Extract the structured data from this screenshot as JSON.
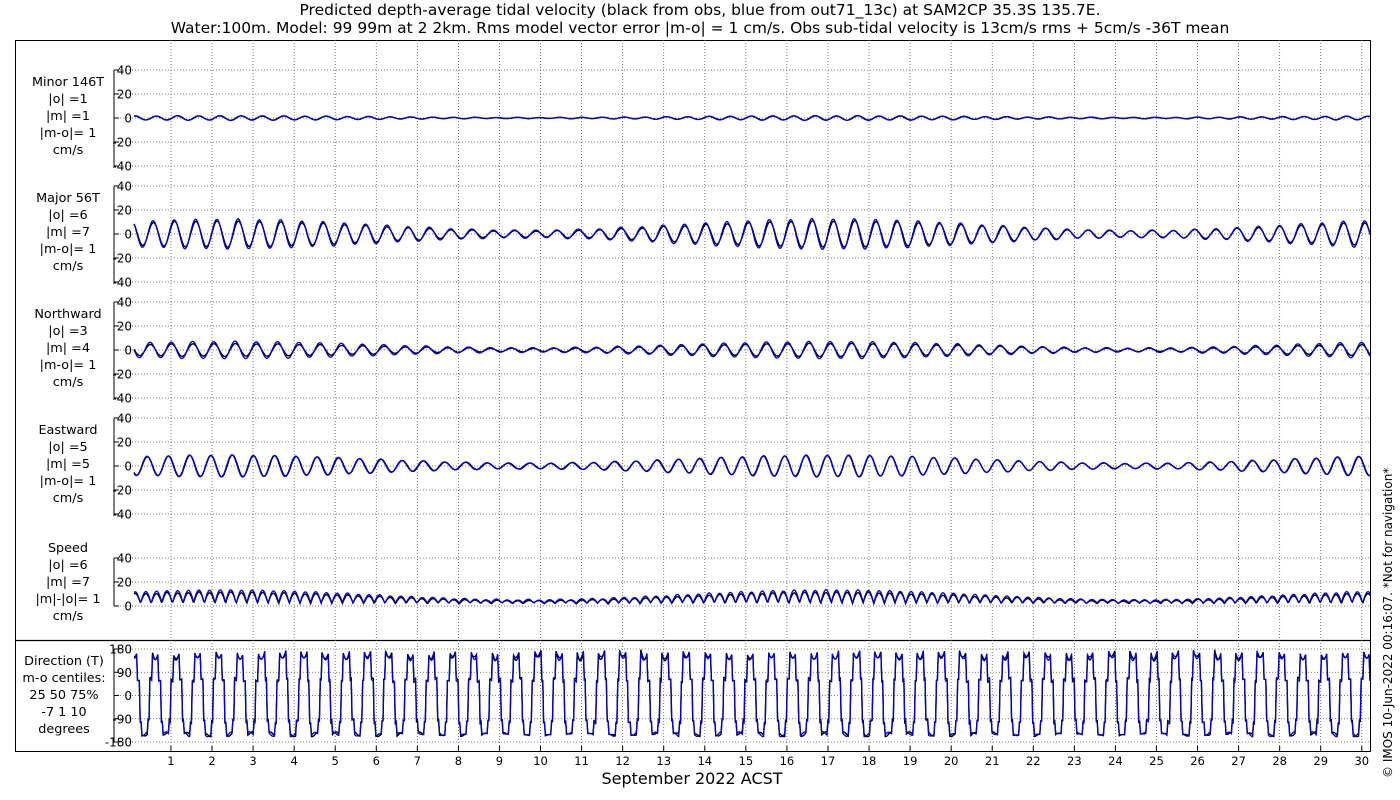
{
  "title_lines": [
    "Predicted depth-average tidal velocity (black from obs, blue from out71_13c) at SAM2CP 35.3S 135.7E.",
    "Water:100m. Model: 99 99m at 2 2km. Rms model vector error |m-o| = 1 cm/s. Obs sub-tidal velocity is 13cm/s rms + 5cm/s -36T mean"
  ],
  "credit": "© IMOS 10-Jun-2022 00:16:07.  *Not for navigation*",
  "colors": {
    "obs": "#000000",
    "model": "#0000cc",
    "grid": "#555555"
  },
  "chart_data": [
    {
      "type": "line",
      "name_label": [
        "Minor 146T",
        "|o| =1",
        "|m| =1",
        "|m-o|= 1",
        "cm/s"
      ],
      "ylim": [
        -40,
        40
      ],
      "yticks": [
        -40,
        -20,
        0,
        20,
        40
      ],
      "grid": true,
      "series": [
        {
          "name": "black from obs",
          "amplitude": 1,
          "mean": 0
        },
        {
          "name": "blue from out71_13c",
          "amplitude": 1,
          "mean": 0
        }
      ]
    },
    {
      "type": "line",
      "name_label": [
        "Major 56T",
        "|o| =6",
        "|m| =7",
        "|m-o|= 1",
        "cm/s"
      ],
      "ylim": [
        -40,
        40
      ],
      "yticks": [
        -40,
        -20,
        0,
        20,
        40
      ],
      "grid": true,
      "series": [
        {
          "name": "black from obs",
          "amplitude": 6,
          "mean": 0
        },
        {
          "name": "blue from out71_13c",
          "amplitude": 7,
          "mean": 0
        }
      ]
    },
    {
      "type": "line",
      "name_label": [
        "Northward",
        "|o| =3",
        "|m| =4",
        "|m-o|= 1",
        "cm/s"
      ],
      "ylim": [
        -40,
        40
      ],
      "yticks": [
        -40,
        -20,
        0,
        20,
        40
      ],
      "grid": true,
      "series": [
        {
          "name": "black from obs",
          "amplitude": 3,
          "mean": 0
        },
        {
          "name": "blue from out71_13c",
          "amplitude": 4,
          "mean": 0
        }
      ]
    },
    {
      "type": "line",
      "name_label": [
        "Eastward",
        "|o| =5",
        "|m| =5",
        "|m-o|= 1",
        "cm/s"
      ],
      "ylim": [
        -40,
        40
      ],
      "yticks": [
        -40,
        -20,
        0,
        20,
        40
      ],
      "grid": true,
      "series": [
        {
          "name": "black from obs",
          "amplitude": 5,
          "mean": 0
        },
        {
          "name": "blue from out71_13c",
          "amplitude": 5,
          "mean": 0
        }
      ]
    },
    {
      "type": "line",
      "name_label": [
        "Speed",
        "|o| =6",
        "|m| =7",
        "|m|-|o|= 1",
        "cm/s"
      ],
      "ylim": [
        0,
        40
      ],
      "yticks": [
        0,
        20,
        40
      ],
      "grid": true,
      "series": [
        {
          "name": "black from obs",
          "amplitude": 6,
          "mean": 6
        },
        {
          "name": "blue from out71_13c",
          "amplitude": 7,
          "mean": 7
        }
      ]
    },
    {
      "type": "line",
      "name_label": [
        "Direction (T)",
        "m-o centiles:",
        "25  50  75%",
        "-7   1  10",
        "degrees"
      ],
      "ylim": [
        -180,
        180
      ],
      "yticks": [
        -180,
        -90,
        0,
        90,
        180
      ],
      "grid": true,
      "centiles": {
        "25": -7,
        "50": 1,
        "75": 10
      },
      "series": [
        {
          "name": "black from obs"
        },
        {
          "name": "blue from out71_13c"
        }
      ]
    }
  ],
  "x_axis": {
    "label": "September 2022 ACST",
    "ticks": [
      "1",
      "2",
      "3",
      "4",
      "5",
      "6",
      "7",
      "8",
      "9",
      "10",
      "11",
      "12",
      "13",
      "14",
      "15",
      "16",
      "17",
      "18",
      "19",
      "20",
      "21",
      "22",
      "23",
      "24",
      "25",
      "26",
      "27",
      "28",
      "29",
      "30"
    ],
    "xlim": [
      0.1,
      30.2
    ]
  }
}
